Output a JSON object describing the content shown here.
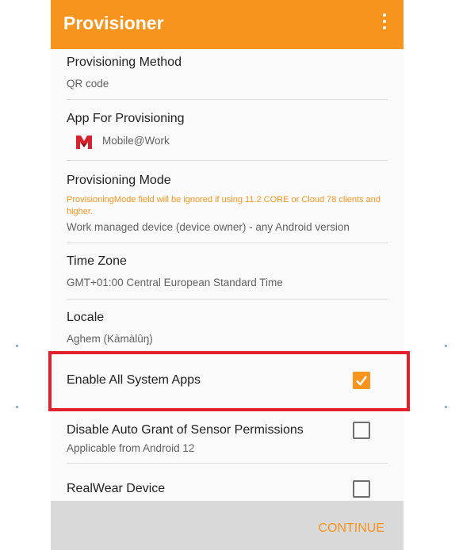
{
  "appbar": {
    "title": "Provisioner",
    "menu_icon": "more-vertical-icon"
  },
  "settings": {
    "provisioning_method": {
      "title": "Provisioning Method",
      "value": "QR code"
    },
    "app_for_provisioning": {
      "title": "App For Provisioning",
      "app_name": "Mobile@Work",
      "app_icon": "mobileiron-logo-icon",
      "logo_color": "#d6212f"
    },
    "provisioning_mode": {
      "title": "Provisioning Mode",
      "warning": "ProvisioningMode field will be ignored if using 11.2 CORE or Cloud 78 clients and higher.",
      "value": "Work managed device (device owner) - any Android version"
    },
    "time_zone": {
      "title": "Time Zone",
      "value": "GMT+01:00 Central European Standard Time"
    },
    "locale": {
      "title": "Locale",
      "value": "Aghem (Kàmàlûŋ)"
    },
    "enable_all_system_apps": {
      "title": "Enable All System Apps",
      "checked": true
    },
    "disable_auto_grant": {
      "title": "Disable Auto Grant of Sensor Permissions",
      "value": "Applicable from Android 12",
      "checked": false
    },
    "realwear_device": {
      "title": "RealWear Device",
      "checked": false
    }
  },
  "footer": {
    "continue_label": "CONTINUE"
  },
  "colors": {
    "accent": "#f7941d",
    "highlight": "#e3202b",
    "bottom_bar": "#d9d9d9"
  }
}
